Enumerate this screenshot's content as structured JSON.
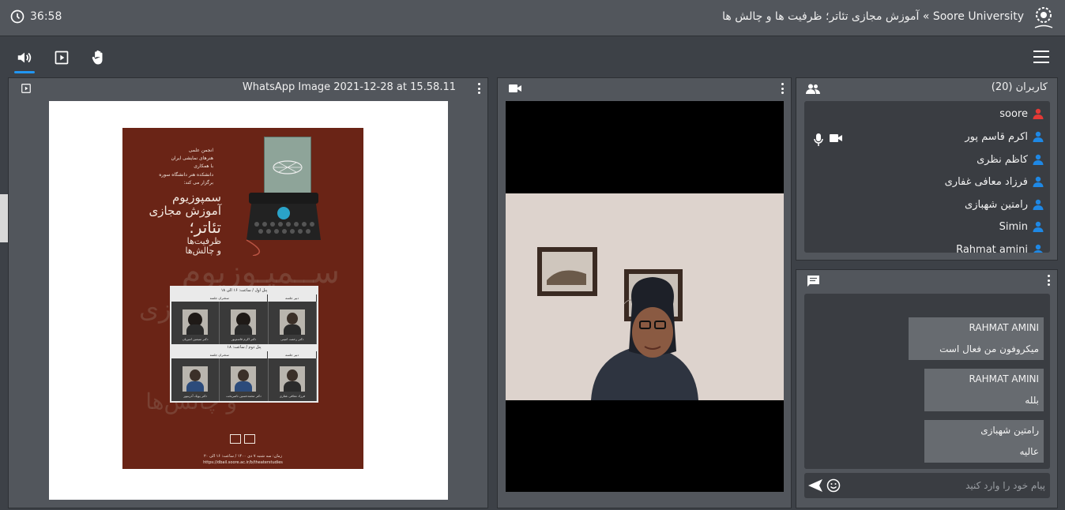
{
  "header": {
    "timer": "36:58",
    "title": "Soore University » آموزش مجازی تئاتر؛ ظرفیت ها و چالش ها"
  },
  "toolbar": {
    "audio_icon": "speaker-icon",
    "present_icon": "presentation-icon",
    "hand_icon": "raise-hand-icon",
    "menu_icon": "hamburger-menu-icon",
    "active_color": "#2196f3"
  },
  "presentation": {
    "title": "WhatsApp Image 2021-12-28 at 15.58.11",
    "poster": {
      "org_lines": [
        "انجمن علمی",
        "هنرهای نمایشی ایران",
        "با همکاری",
        "دانشکده هنر دانشگاه سوره",
        "برگزار می کند:"
      ],
      "headline_lines": [
        "سمپوزیوم",
        "آموزش مجازی",
        "تئاتر؛",
        "ظرفیت‌ها",
        "و چالش‌ها"
      ],
      "panel1_title": "پنل اول / ساعت: ۱۶ الی ۱۸",
      "panel2_title": "پنل دوم / ساعت: ۱۸",
      "col_moderator": "دبیر جلسه",
      "col_speakers": "سخنران جلسه",
      "panel1_people": [
        "دکتر سیمین امیریان",
        "دکتر اکرم قاسم‌پور",
        "دکتر رحمت امینی"
      ],
      "panel2_people": [
        "دکتر پوپک آذرینپور",
        "دکتر محمدحسین ناصربخت",
        "فرزاد معافی غفاری"
      ],
      "footer_date": "زمان: سه شنبه ۷ دی ۱۴۰۰ / ساعت: ۱۶ الی ۲۰",
      "footer_url": "https://dbail.soore.ac.ir/b/theaterstudies"
    }
  },
  "video": {
    "camera_icon": "video-camera-icon"
  },
  "users": {
    "title": "کاربران (20)",
    "list": [
      {
        "name": "soore",
        "color": "#e53935"
      },
      {
        "name": "اکرم قاسم پور",
        "color": "#1e88e5"
      },
      {
        "name": "کاظم نظری",
        "color": "#1e88e5"
      },
      {
        "name": "فرزاد معافی غفاری",
        "color": "#1e88e5"
      },
      {
        "name": "رامتین شهبازی",
        "color": "#1e88e5"
      },
      {
        "name": "Simin",
        "color": "#1e88e5"
      },
      {
        "name": "Rahmat amini",
        "color": "#1e88e5"
      }
    ]
  },
  "chat": {
    "messages": [
      {
        "sender": "RAHMAT AMINI",
        "text": "میکروفون من فعال است"
      },
      {
        "sender": "RAHMAT AMINI",
        "text": "بلله"
      },
      {
        "sender": "رامتین شهبازی",
        "text": "عالیه"
      }
    ],
    "input_placeholder": "پیام خود را وارد کنید"
  }
}
